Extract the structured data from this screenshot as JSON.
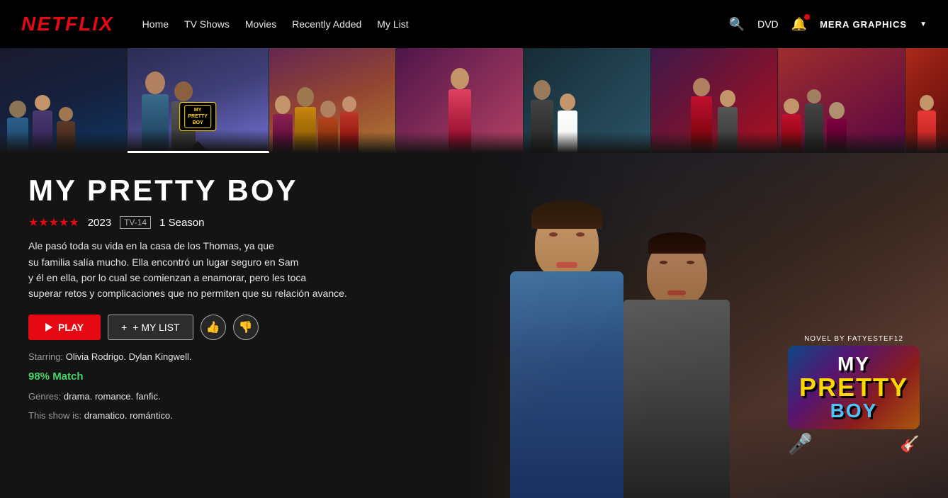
{
  "navbar": {
    "logo": "NETFLIX",
    "links": [
      {
        "label": "Home",
        "id": "home"
      },
      {
        "label": "TV Shows",
        "id": "tv-shows"
      },
      {
        "label": "Movies",
        "id": "movies"
      },
      {
        "label": "Recently Added",
        "id": "recently-added"
      },
      {
        "label": "My List",
        "id": "my-list"
      }
    ],
    "dvd_label": "DVD",
    "user_name": "MERA GRAPHICS"
  },
  "thumbnails": [
    {
      "id": 0,
      "color_class": "thumb-0",
      "active": false
    },
    {
      "id": 1,
      "color_class": "thumb-1",
      "active": true,
      "label": "MY\nPRETTY\nBOY"
    },
    {
      "id": 2,
      "color_class": "thumb-2",
      "active": false
    },
    {
      "id": 3,
      "color_class": "thumb-3",
      "active": false
    },
    {
      "id": 4,
      "color_class": "thumb-4",
      "active": false
    },
    {
      "id": 5,
      "color_class": "thumb-5",
      "active": false
    },
    {
      "id": 6,
      "color_class": "thumb-6",
      "active": false
    },
    {
      "id": 7,
      "color_class": "thumb-7",
      "active": false
    }
  ],
  "show": {
    "title": "MY PRETTY BOY",
    "stars": "★★★★★",
    "year": "2023",
    "rating": "TV-14",
    "season": "1 Season",
    "description": "Ale pasó toda su vida en la casa de los Thomas, ya que\nsu familia salía mucho. Ella encontró un lugar seguro en Sam\ny él en ella, por lo cual se comienzan a enamorar, pero les toca\nsuperar retos y complicaciones que no permiten que su relación avance.",
    "play_label": "PLAY",
    "mylist_label": "+ MY LIST",
    "starring_label": "Starring:",
    "starring": "Olivia Rodrigo. Dylan Kingwell.",
    "match_percent": "98% Match",
    "genres_label": "Genres:",
    "genres": "drama. romance. fanfic.",
    "showis_label": "This show is:",
    "showis": "dramatico. romántico.",
    "logo_novel_by": "NOVEL BY FATYESTEF12",
    "logo_my": "MY",
    "logo_pretty": "PRETTY",
    "logo_boy": "BOY"
  }
}
